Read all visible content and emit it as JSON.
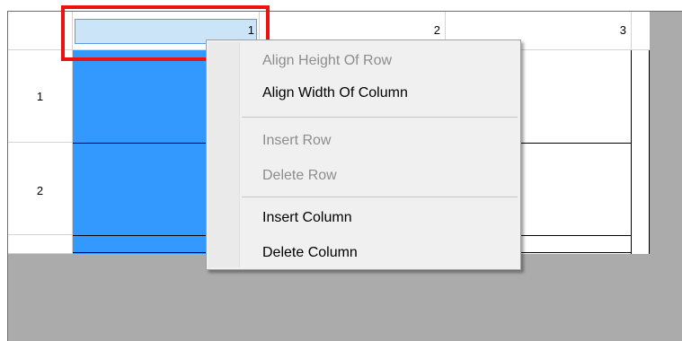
{
  "grid": {
    "column_headers": [
      "1",
      "2",
      "3"
    ],
    "row_headers": [
      "1",
      "2"
    ]
  },
  "context_menu": {
    "items": [
      {
        "label": "Align Height Of Row",
        "enabled": false
      },
      {
        "label": "Align Width Of Column",
        "enabled": true
      },
      {
        "label": "Insert Row",
        "enabled": false
      },
      {
        "label": "Delete Row",
        "enabled": false
      },
      {
        "label": "Insert Column",
        "enabled": true
      },
      {
        "label": "Delete Column",
        "enabled": true
      }
    ]
  },
  "colors": {
    "selection": "#3399ff",
    "selected_header": "#cce4f7",
    "highlight_box": "#ee1111",
    "background": "#ababab"
  }
}
